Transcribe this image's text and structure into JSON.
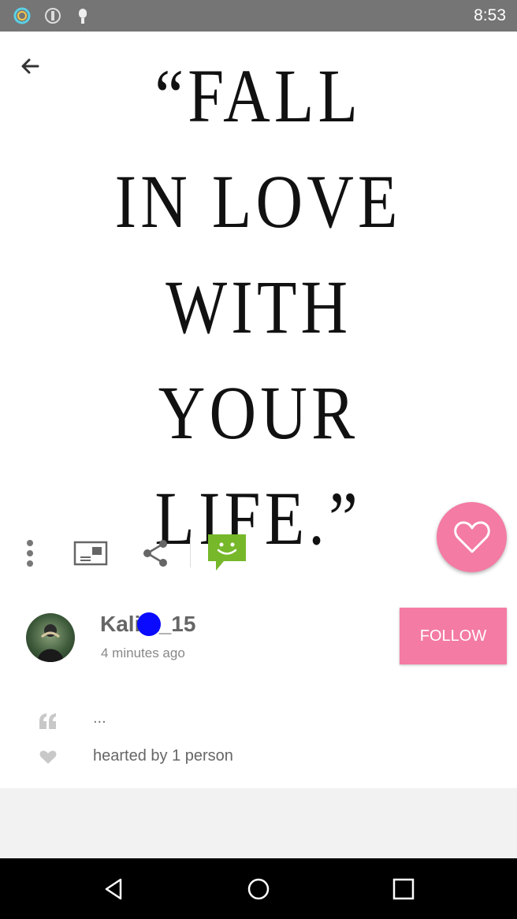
{
  "status_bar": {
    "time": "8:53",
    "icons": [
      "circle-logo-icon",
      "info-icon",
      "android-icon"
    ]
  },
  "post": {
    "quote_lines": [
      "“FALL",
      "IN LOVE",
      "WITH",
      "YOUR",
      "LIFE.”"
    ],
    "actions": [
      "more-vert-icon",
      "postcard-icon",
      "share-icon",
      "message-icon"
    ],
    "accent_color": "#f47ba3",
    "message_icon_color": "#76b82a"
  },
  "author": {
    "username": "Kali a_15",
    "time_ago": "4 minutes ago",
    "follow_label": "FOLLOW"
  },
  "details": {
    "caption": "...",
    "hearted_text": "hearted by 1 person"
  }
}
